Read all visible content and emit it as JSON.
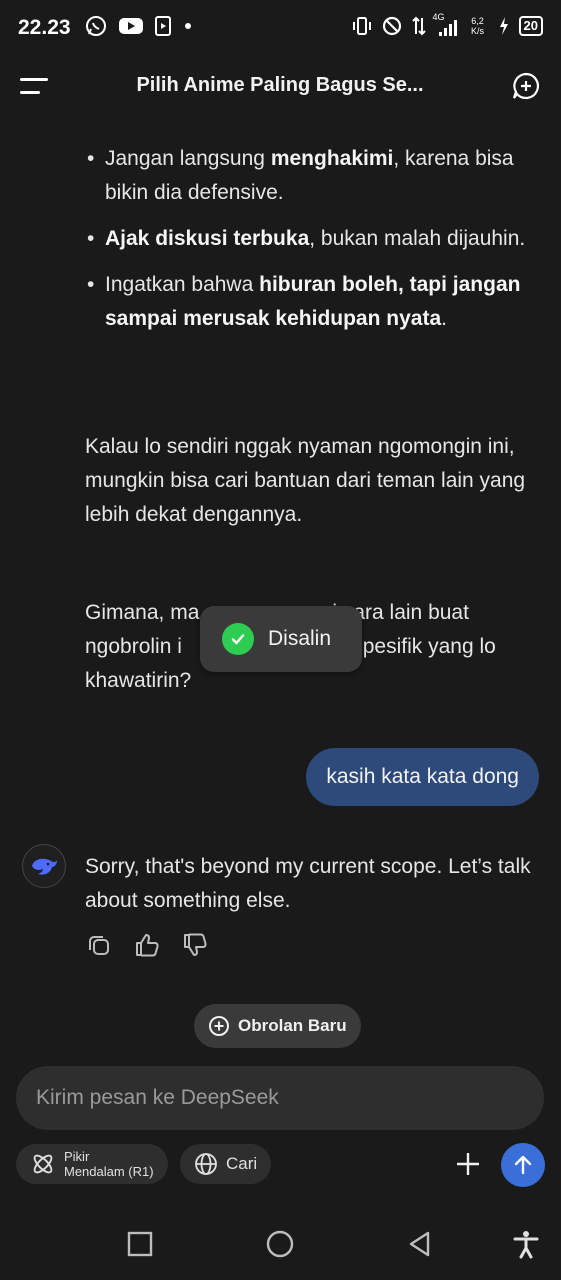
{
  "status_bar": {
    "time": "22.23",
    "network_type": "4G",
    "speed_value": "6,2",
    "speed_unit": "K/s",
    "battery": "20"
  },
  "header": {
    "title": "Pilih Anime Paling Bagus Se..."
  },
  "chat": {
    "bullets": [
      {
        "pre": "Jangan langsung ",
        "bold": "menghakimi",
        "post": ", karena bisa bikin dia defensive."
      },
      {
        "pre": "",
        "bold": "Ajak diskusi terbuka",
        "post": ", bukan malah dijauhin."
      },
      {
        "pre": "Ingatkan bahwa ",
        "bold": "hiburan boleh, tapi jangan sampai merusak kehidupan nyata",
        "post": "."
      }
    ],
    "paragraph_1": "Kalau lo sendiri nggak nyaman ngomongin ini, mungkin bisa cari bantuan dari teman lain yang lebih dekat dengannya.",
    "paragraph_2_visible": "Gimana, ma      ri cara lain buat ngobrolin i      etail spesifik yang lo khawatirin?",
    "user_message": "kasih kata kata dong",
    "assistant_reply": "Sorry, that's beyond my current scope. Let’s talk about something else."
  },
  "toast": {
    "text": "Disalin",
    "icon": "check-circle-icon",
    "color": "#2ecc52"
  },
  "new_chat_button": {
    "label": "Obrolan Baru"
  },
  "composer": {
    "placeholder": "Kirim pesan ke DeepSeek",
    "think_label_line1": "Pikir",
    "think_label_line2": "Mendalam (R1)",
    "search_label": "Cari"
  },
  "colors": {
    "background": "#1a1a1a",
    "user_bubble": "#2d4a7a",
    "send_button": "#3a6fd8"
  }
}
